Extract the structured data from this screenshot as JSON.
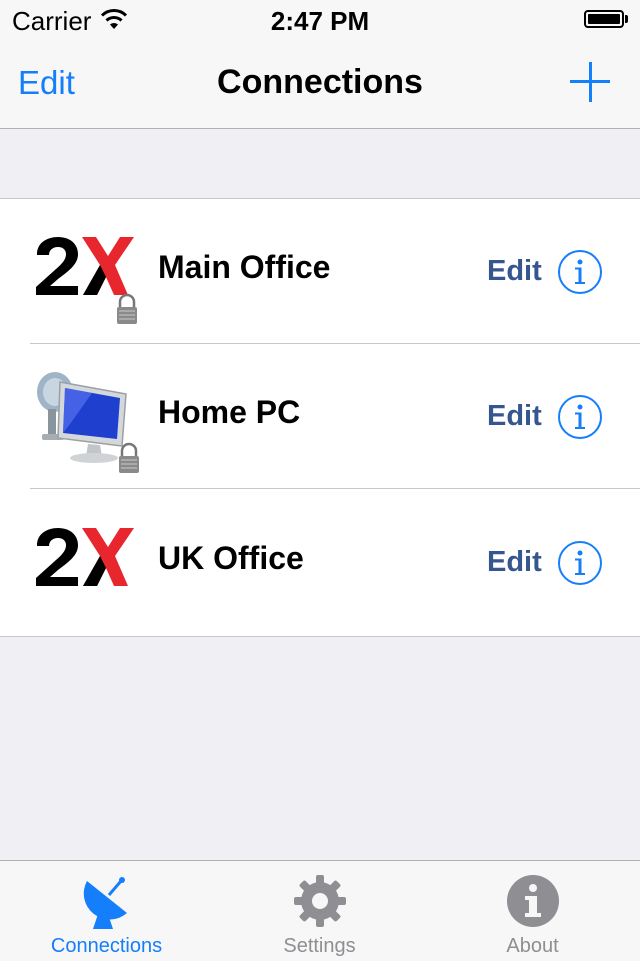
{
  "status_bar": {
    "carrier": "Carrier",
    "time": "2:47 PM"
  },
  "nav": {
    "edit_label": "Edit",
    "title": "Connections"
  },
  "connections": [
    {
      "name": "Main Office",
      "edit_label": "Edit",
      "icon": "2x-logo-icon",
      "locked": true
    },
    {
      "name": "Home PC",
      "edit_label": "Edit",
      "icon": "remote-desktop-pc-icon",
      "locked": true
    },
    {
      "name": "UK Office",
      "edit_label": "Edit",
      "icon": "2x-logo-icon",
      "locked": false
    }
  ],
  "tabs": [
    {
      "label": "Connections",
      "icon": "satellite-dish-icon",
      "selected": true
    },
    {
      "label": "Settings",
      "icon": "gear-icon",
      "selected": false
    },
    {
      "label": "About",
      "icon": "info-icon",
      "selected": false
    }
  ],
  "colors": {
    "tint": "#147efb",
    "edit_text": "#35568f",
    "inactive_tab": "#8e8e93",
    "logo_red": "#e8262d"
  }
}
